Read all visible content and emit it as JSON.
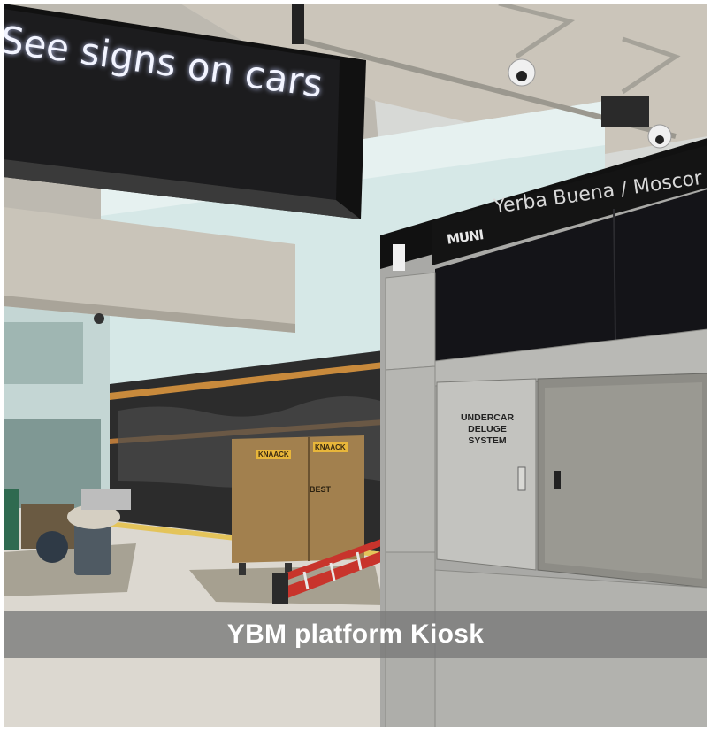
{
  "caption": "YBM platform Kiosk",
  "overhead_sign": {
    "text": "See signs on cars"
  },
  "kiosk": {
    "station_sign": "Yerba Buena / Moscor",
    "logo": "MUNI",
    "door_label_line1": "UNDERCAR DELUGE",
    "door_label_line2": "SYSTEM"
  },
  "equipment_box": {
    "brand_left": "KNAACK",
    "brand_right": "KNAACK",
    "stencil": "BEST"
  },
  "colors": {
    "caption_band": "#787878",
    "kiosk_steel": "#a9a9a6",
    "ceiling_concrete": "#c9c3b8",
    "platform_floor": "#d9d6cf",
    "wall_glass": "#cfe3e3",
    "ladder_red": "#c8342c",
    "box_brown": "#9a7a4a"
  }
}
